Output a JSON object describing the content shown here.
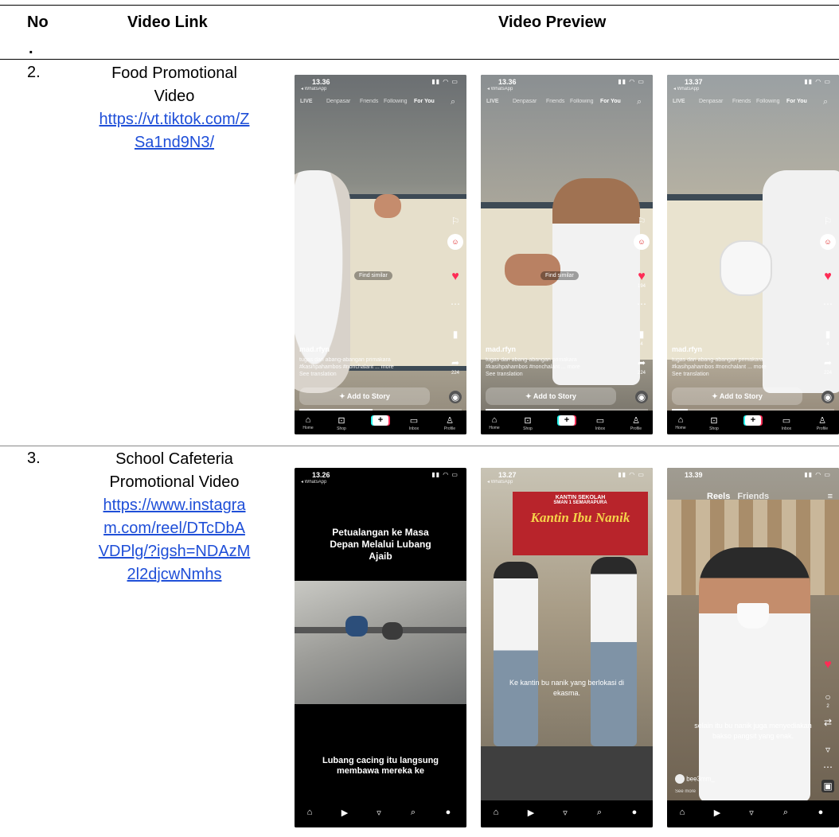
{
  "table": {
    "headers": {
      "no": "No",
      "no_dot": ".",
      "link": "Video Link",
      "preview": "Video Preview"
    },
    "rows": [
      {
        "number": "2.",
        "title_lines": [
          "Food Promotional",
          "Video"
        ],
        "url_lines": [
          "https://vt.tiktok.com/Z",
          "Sa1nd9N3/"
        ]
      },
      {
        "number": "3.",
        "title_lines": [
          "School Cafeteria",
          "Promotional Video"
        ],
        "url_lines": [
          "https://www.instagra",
          "m.com/reel/DTcDbA",
          "VDPlg/?igsh=NDAzM",
          "2l2djcwNmhs"
        ]
      }
    ]
  },
  "tiktok": {
    "whatsapp": "◂ WhatsApp",
    "live": "LIVE",
    "nav": [
      "Denpasar",
      "Friends",
      "Following",
      "For You"
    ],
    "username": "mad.rfyn",
    "caption_line1": "tugas dari abang-abangan primakara",
    "caption_line2": "#kasihpahambos #nonchalant ... more",
    "see_translation": "See translation",
    "add_to_story": "✦ Add to Story",
    "find_similar": "Find similar",
    "tabs": [
      "Home",
      "Shop",
      "",
      "Inbox",
      "Profile"
    ],
    "screens": [
      {
        "time": "13.36",
        "likes": "",
        "saves": "",
        "shares": "224",
        "progress": 0.45
      },
      {
        "time": "13.36",
        "likes": "194",
        "saves": "4",
        "shares": "224",
        "progress": 0.45
      },
      {
        "time": "13.37",
        "likes": "",
        "saves": "4",
        "shares": "224",
        "progress": 0.1
      }
    ]
  },
  "instagram": {
    "screens": [
      {
        "time": "13.26",
        "top_text": "Petualangan ke Masa Depan Melalui Lubang Ajaib",
        "bottom_text": "Lubang cacing itu langsung membawa mereka ke"
      },
      {
        "time": "13.27",
        "sign_line1": "KANTIN SEKOLAH",
        "sign_line2": "SMAN 1 SEMARAPURA",
        "sign_main": "Kantin Ibu Nanik",
        "caption": "Ke kantin bu nanik yang berlokasi di ekasma."
      },
      {
        "time": "13.39",
        "reels": "Reels",
        "friends": "Friends",
        "caption": "selain itu bu nanik juga menyediakan bakso pangsit yang enak.",
        "user": "bee3mm_",
        "see_more": "See more",
        "comment_count": "2"
      }
    ]
  },
  "colors": {
    "link": "#1f4fd8",
    "rule": "#000000",
    "like": "#fe2c55"
  }
}
